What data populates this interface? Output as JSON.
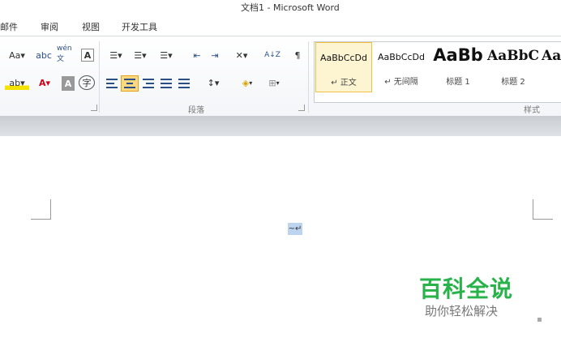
{
  "window": {
    "title": "文档1 - Microsoft Word"
  },
  "tabs": [
    "邮件",
    "审阅",
    "视图",
    "开发工具"
  ],
  "font_group": {
    "row1": [
      "Aa▾",
      "abc",
      "wén 文",
      "A"
    ],
    "row2": [
      "ab▾",
      "A▾",
      "A",
      "字"
    ]
  },
  "paragraph_group": {
    "label": "段落",
    "row1": [
      "☰▾",
      "☰▾",
      "☰▾",
      "⇤",
      "⇥",
      "✕▾",
      "A↓Z",
      "¶"
    ],
    "row2": [
      "align-left",
      "align-center",
      "align-right",
      "justify",
      "distributed",
      "↕▾",
      "shading▾",
      "borders▾"
    ]
  },
  "styles_group": {
    "label": "样式",
    "items": [
      {
        "sample": "AaBbCcDd",
        "name": "↵ 正文",
        "selected": true
      },
      {
        "sample": "AaBbCcDd",
        "name": "↵ 无间隔",
        "selected": false
      },
      {
        "sample": "AaBb",
        "name": "标题 1",
        "selected": false
      },
      {
        "sample": "AaBbC",
        "name": "标题 2",
        "selected": false
      },
      {
        "sample": "Aa",
        "name": "",
        "selected": false
      }
    ]
  },
  "document": {
    "cursor_mark": "~↵"
  },
  "watermark": {
    "main": "百科全说",
    "sub": "助你轻松解决"
  },
  "colors": {
    "accent_green": "#27b34a",
    "highlight": "#fcd980",
    "selection": "#bcd4f0"
  }
}
